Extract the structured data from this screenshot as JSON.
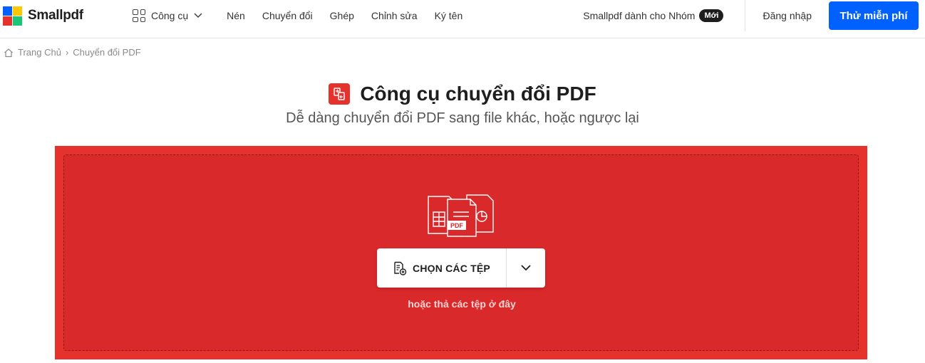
{
  "brand": {
    "name": "Smallpdf",
    "logo_colors": [
      "#0061fe",
      "#ffc700",
      "#e5322d",
      "#1ac776"
    ]
  },
  "nav": {
    "tools_label": "Công cụ",
    "items": [
      "Nén",
      "Chuyển đổi",
      "Ghép",
      "Chỉnh sửa",
      "Ký tên"
    ]
  },
  "header_right": {
    "team_label": "Smallpdf dành cho Nhóm",
    "team_badge": "Mới",
    "login_label": "Đăng nhập",
    "try_label": "Thử miễn phí"
  },
  "breadcrumb": {
    "home": "Trang Chủ",
    "separator": "›",
    "current": "Chuyển đổi PDF"
  },
  "page": {
    "title": "Công cụ chuyển đổi PDF",
    "subtitle": "Dễ dàng chuyển đổi PDF sang file khác, hoặc ngược lại"
  },
  "dropzone": {
    "pdf_label": "PDF",
    "choose_label": "CHỌN CÁC TỆP",
    "drop_hint": "hoặc thả các tệp ở đây",
    "accent": "#e5322d",
    "primary": "#0061fe"
  }
}
